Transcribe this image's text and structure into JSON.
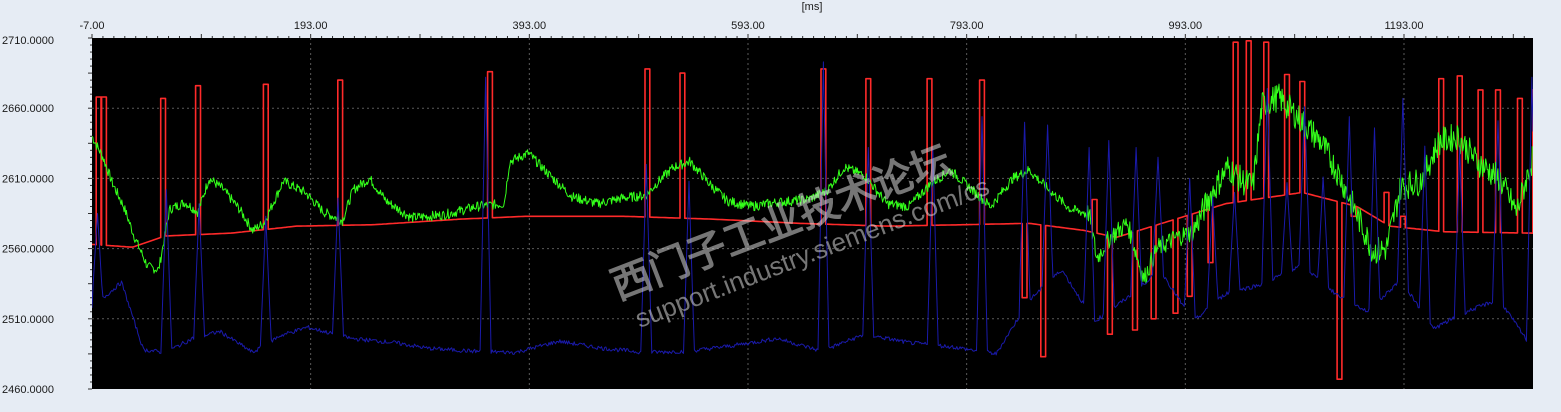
{
  "chart_data": {
    "type": "line",
    "x_unit_label": "[ms]",
    "xlim": [
      -7,
      1311
    ],
    "ylim": [
      2460,
      2710
    ],
    "x_ticks": [
      "-7.00",
      "193.00",
      "393.00",
      "593.00",
      "793.00",
      "993.00",
      "1193.00"
    ],
    "x_tick_values": [
      -7,
      193,
      393,
      593,
      793,
      993,
      1193
    ],
    "y_ticks": [
      "2710.0000",
      "2660.0000",
      "2610.0000",
      "2560.0000",
      "2510.0000",
      "2460.0000"
    ],
    "y_tick_values": [
      2710,
      2660,
      2610,
      2560,
      2510,
      2460
    ],
    "grid": true,
    "background": "#000000",
    "series": [
      {
        "color": "#ff2a2a",
        "style": "baseline_with_pulses",
        "baseline": [
          [
            -7,
            2563
          ],
          [
            30,
            2561
          ],
          [
            60,
            2569
          ],
          [
            120,
            2571
          ],
          [
            180,
            2576
          ],
          [
            250,
            2577
          ],
          [
            330,
            2581
          ],
          [
            390,
            2583
          ],
          [
            480,
            2583
          ],
          [
            560,
            2581
          ],
          [
            640,
            2578
          ],
          [
            720,
            2576
          ],
          [
            790,
            2577
          ],
          [
            850,
            2578
          ],
          [
            900,
            2573
          ],
          [
            930,
            2568
          ],
          [
            980,
            2580
          ],
          [
            1030,
            2592
          ],
          [
            1100,
            2600
          ],
          [
            1150,
            2590
          ],
          [
            1180,
            2576
          ],
          [
            1230,
            2572
          ],
          [
            1311,
            2571
          ]
        ],
        "pulses": [
          [
            -7,
            1
          ],
          [
            -1,
            2668
          ],
          [
            4,
            2668
          ],
          [
            58,
            2667
          ],
          [
            90,
            2676
          ],
          [
            152,
            2677
          ],
          [
            220,
            2680
          ],
          [
            357,
            2686
          ],
          [
            501,
            2688
          ],
          [
            533,
            2685
          ],
          [
            662,
            2688
          ],
          [
            703,
            2681
          ],
          [
            759,
            2681
          ],
          [
            807,
            2680
          ],
          [
            846,
            2525
          ],
          [
            863,
            2483
          ],
          [
            910,
            2595
          ],
          [
            924,
            2499
          ],
          [
            947,
            2502
          ],
          [
            964,
            2510
          ],
          [
            984,
            2514
          ],
          [
            997,
            2526
          ],
          [
            1016,
            2550
          ],
          [
            1039,
            2707
          ],
          [
            1051,
            2708
          ],
          [
            1067,
            2707
          ],
          [
            1086,
            2684
          ],
          [
            1100,
            2679
          ],
          [
            1134,
            2467
          ],
          [
            1147,
            2583
          ],
          [
            1177,
            2600
          ],
          [
            1192,
            2583
          ],
          [
            1227,
            2681
          ],
          [
            1244,
            2683
          ],
          [
            1263,
            2673
          ],
          [
            1279,
            2673
          ],
          [
            1299,
            2667
          ],
          [
            1313,
            2673
          ]
        ]
      },
      {
        "color": "#33ff1a",
        "style": "noisy_line",
        "points": [
          [
            -7,
            2640
          ],
          [
            3,
            2625
          ],
          [
            12,
            2606
          ],
          [
            22,
            2590
          ],
          [
            32,
            2568
          ],
          [
            44,
            2547
          ],
          [
            54,
            2545
          ],
          [
            64,
            2588
          ],
          [
            78,
            2593
          ],
          [
            90,
            2586
          ],
          [
            100,
            2610
          ],
          [
            112,
            2603
          ],
          [
            128,
            2588
          ],
          [
            140,
            2573
          ],
          [
            150,
            2578
          ],
          [
            168,
            2608
          ],
          [
            188,
            2600
          ],
          [
            205,
            2586
          ],
          [
            222,
            2580
          ],
          [
            232,
            2602
          ],
          [
            247,
            2610
          ],
          [
            262,
            2594
          ],
          [
            285,
            2582
          ],
          [
            315,
            2584
          ],
          [
            345,
            2590
          ],
          [
            370,
            2592
          ],
          [
            375,
            2622
          ],
          [
            392,
            2628
          ],
          [
            412,
            2612
          ],
          [
            432,
            2597
          ],
          [
            455,
            2592
          ],
          [
            478,
            2596
          ],
          [
            500,
            2598
          ],
          [
            510,
            2607
          ],
          [
            525,
            2618
          ],
          [
            540,
            2622
          ],
          [
            558,
            2606
          ],
          [
            574,
            2594
          ],
          [
            596,
            2590
          ],
          [
            620,
            2593
          ],
          [
            648,
            2595
          ],
          [
            665,
            2601
          ],
          [
            681,
            2618
          ],
          [
            700,
            2612
          ],
          [
            720,
            2592
          ],
          [
            740,
            2590
          ],
          [
            760,
            2606
          ],
          [
            778,
            2616
          ],
          [
            795,
            2604
          ],
          [
            815,
            2590
          ],
          [
            835,
            2610
          ],
          [
            850,
            2616
          ],
          [
            868,
            2602
          ],
          [
            888,
            2588
          ],
          [
            905,
            2585
          ],
          [
            912,
            2553
          ],
          [
            924,
            2568
          ],
          [
            940,
            2578
          ],
          [
            955,
            2538
          ],
          [
            967,
            2560
          ],
          [
            985,
            2568
          ],
          [
            1000,
            2572
          ],
          [
            1016,
            2598
          ],
          [
            1032,
            2618
          ],
          [
            1045,
            2608
          ],
          [
            1055,
            2605
          ],
          [
            1063,
            2662
          ],
          [
            1078,
            2668
          ],
          [
            1098,
            2652
          ],
          [
            1117,
            2636
          ],
          [
            1134,
            2612
          ],
          [
            1150,
            2584
          ],
          [
            1165,
            2558
          ],
          [
            1177,
            2560
          ],
          [
            1190,
            2604
          ],
          [
            1208,
            2608
          ],
          [
            1225,
            2636
          ],
          [
            1242,
            2640
          ],
          [
            1260,
            2622
          ],
          [
            1280,
            2610
          ],
          [
            1296,
            2586
          ],
          [
            1311,
            2625
          ]
        ]
      },
      {
        "color": "#1a1aaa",
        "style": "spiky_line",
        "baseline": [
          [
            -7,
            2518
          ],
          [
            20,
            2536
          ],
          [
            40,
            2488
          ],
          [
            60,
            2486
          ],
          [
            85,
            2496
          ],
          [
            110,
            2501
          ],
          [
            140,
            2486
          ],
          [
            165,
            2498
          ],
          [
            190,
            2504
          ],
          [
            230,
            2496
          ],
          [
            270,
            2493
          ],
          [
            300,
            2489
          ],
          [
            340,
            2487
          ],
          [
            380,
            2486
          ],
          [
            420,
            2494
          ],
          [
            460,
            2489
          ],
          [
            500,
            2486
          ],
          [
            540,
            2487
          ],
          [
            580,
            2491
          ],
          [
            620,
            2496
          ],
          [
            660,
            2487
          ],
          [
            700,
            2499
          ],
          [
            740,
            2493
          ],
          [
            780,
            2490
          ],
          [
            820,
            2485
          ],
          [
            850,
            2523
          ],
          [
            880,
            2545
          ],
          [
            910,
            2508
          ],
          [
            940,
            2525
          ],
          [
            970,
            2545
          ],
          [
            1000,
            2508
          ],
          [
            1030,
            2528
          ],
          [
            1060,
            2534
          ],
          [
            1100,
            2548
          ],
          [
            1130,
            2528
          ],
          [
            1160,
            2515
          ],
          [
            1190,
            2538
          ],
          [
            1220,
            2503
          ],
          [
            1250,
            2515
          ],
          [
            1280,
            2524
          ],
          [
            1311,
            2488
          ]
        ],
        "spikes": [
          [
            -2,
            2585
          ],
          [
            61,
            2602
          ],
          [
            91,
            2592
          ],
          [
            152,
            2583
          ],
          [
            218,
            2596
          ],
          [
            353,
            2682
          ],
          [
            500,
            2620
          ],
          [
            539,
            2608
          ],
          [
            662,
            2693
          ],
          [
            703,
            2632
          ],
          [
            762,
            2631
          ],
          [
            807,
            2654
          ],
          [
            846,
            2650
          ],
          [
            867,
            2648
          ],
          [
            905,
            2632
          ],
          [
            923,
            2637
          ],
          [
            948,
            2632
          ],
          [
            968,
            2625
          ],
          [
            997,
            2610
          ],
          [
            1018,
            2597
          ],
          [
            1038,
            2600
          ],
          [
            1068,
            2674
          ],
          [
            1086,
            2607
          ],
          [
            1102,
            2661
          ],
          [
            1119,
            2611
          ],
          [
            1143,
            2654
          ],
          [
            1166,
            2646
          ],
          [
            1192,
            2667
          ],
          [
            1212,
            2633
          ],
          [
            1244,
            2632
          ],
          [
            1279,
            2651
          ],
          [
            1310,
            2682
          ]
        ]
      }
    ]
  },
  "watermark": {
    "line1": "西门子工业技术论坛",
    "line2": "support.industry.siemens.com/cs"
  }
}
